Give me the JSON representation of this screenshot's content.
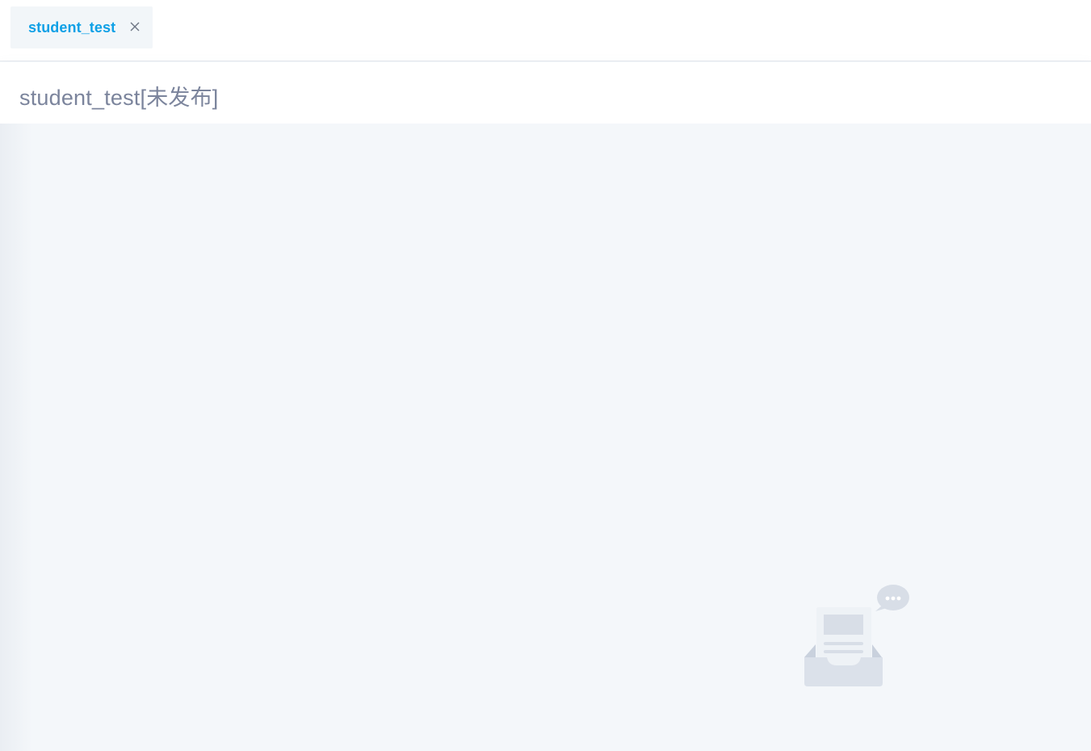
{
  "tabs": [
    {
      "label": "student_test",
      "active": true,
      "close_icon": "close-icon"
    }
  ],
  "header": {
    "title": "student_test[未发布]"
  },
  "content": {
    "empty_state_icon": "empty-inbox-icon"
  },
  "colors": {
    "accent": "#0ea0e6",
    "title_text": "#7b849c",
    "background": "#f4f7fa",
    "illustration": "#d8dee7"
  }
}
